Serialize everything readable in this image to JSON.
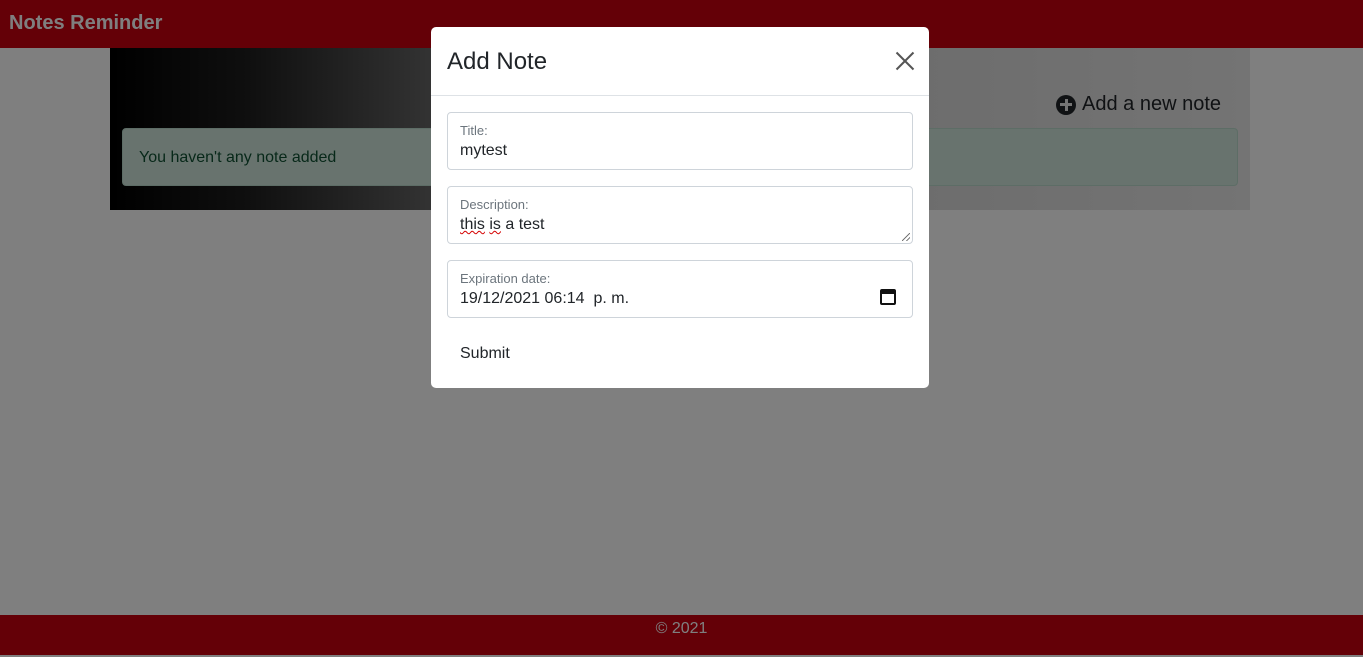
{
  "navbar": {
    "brand": "Notes Reminder"
  },
  "hero": {
    "add_note_label": "Add a new note",
    "alert_text": "You haven't any note added"
  },
  "footer": {
    "copyright": "© 2021"
  },
  "modal": {
    "title": "Add Note",
    "fields": {
      "title": {
        "label": "Title:",
        "value": "mytest"
      },
      "description": {
        "label": "Description:",
        "value_part1": "this",
        "value_part2": "is",
        "value_part3": " a test"
      },
      "expiration": {
        "label": "Expiration date:",
        "value": "19/12/2021 06:14  p. m."
      }
    },
    "submit_label": "Submit"
  },
  "colors": {
    "brand": "#c9000f",
    "alert_bg": "#d1e7dd",
    "alert_text": "#0f5132"
  }
}
